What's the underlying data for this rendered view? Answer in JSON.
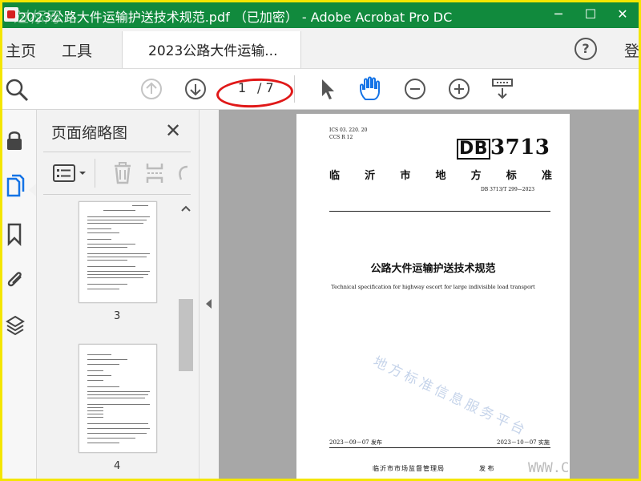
{
  "window": {
    "title": "2023公路大件运输护送技术规范.pdf （已加密） - Adobe Acrobat Pro DC",
    "watermark_logo": "过标网",
    "minimize": "─",
    "restore": "☐",
    "close": "✕"
  },
  "tabs": {
    "home": "主页",
    "tools": "工具",
    "document": "2023公路大件运输...",
    "help": "?",
    "signin": "登"
  },
  "toolbar": {
    "current_page": "1",
    "total_pages": "/ 7"
  },
  "thumbnails": {
    "title": "页面缩略图",
    "close": "✕",
    "pages": [
      {
        "label": "3"
      },
      {
        "label": "4"
      }
    ]
  },
  "document": {
    "ics": "ICS  03. 220. 20",
    "ccs": "CCS  R 12",
    "db_prefix": "DB",
    "db_number": "3713",
    "region_chars": [
      "临",
      "沂",
      "市",
      "地",
      "方",
      "标",
      "准"
    ],
    "code": "DB 3713/T  299—2023",
    "title_zh": "公路大件运输护送技术规范",
    "title_en": "Technical specification for highway escort for large indivisible load transport",
    "watermark": "地方标准信息服务平台",
    "release_date": "2023－09－07 发布",
    "implement_date": "2023－10－07 实施",
    "issuer": "临沂市市场监督管理局",
    "issuer_action": "发 布"
  },
  "watermark_url": "WWW.C"
}
